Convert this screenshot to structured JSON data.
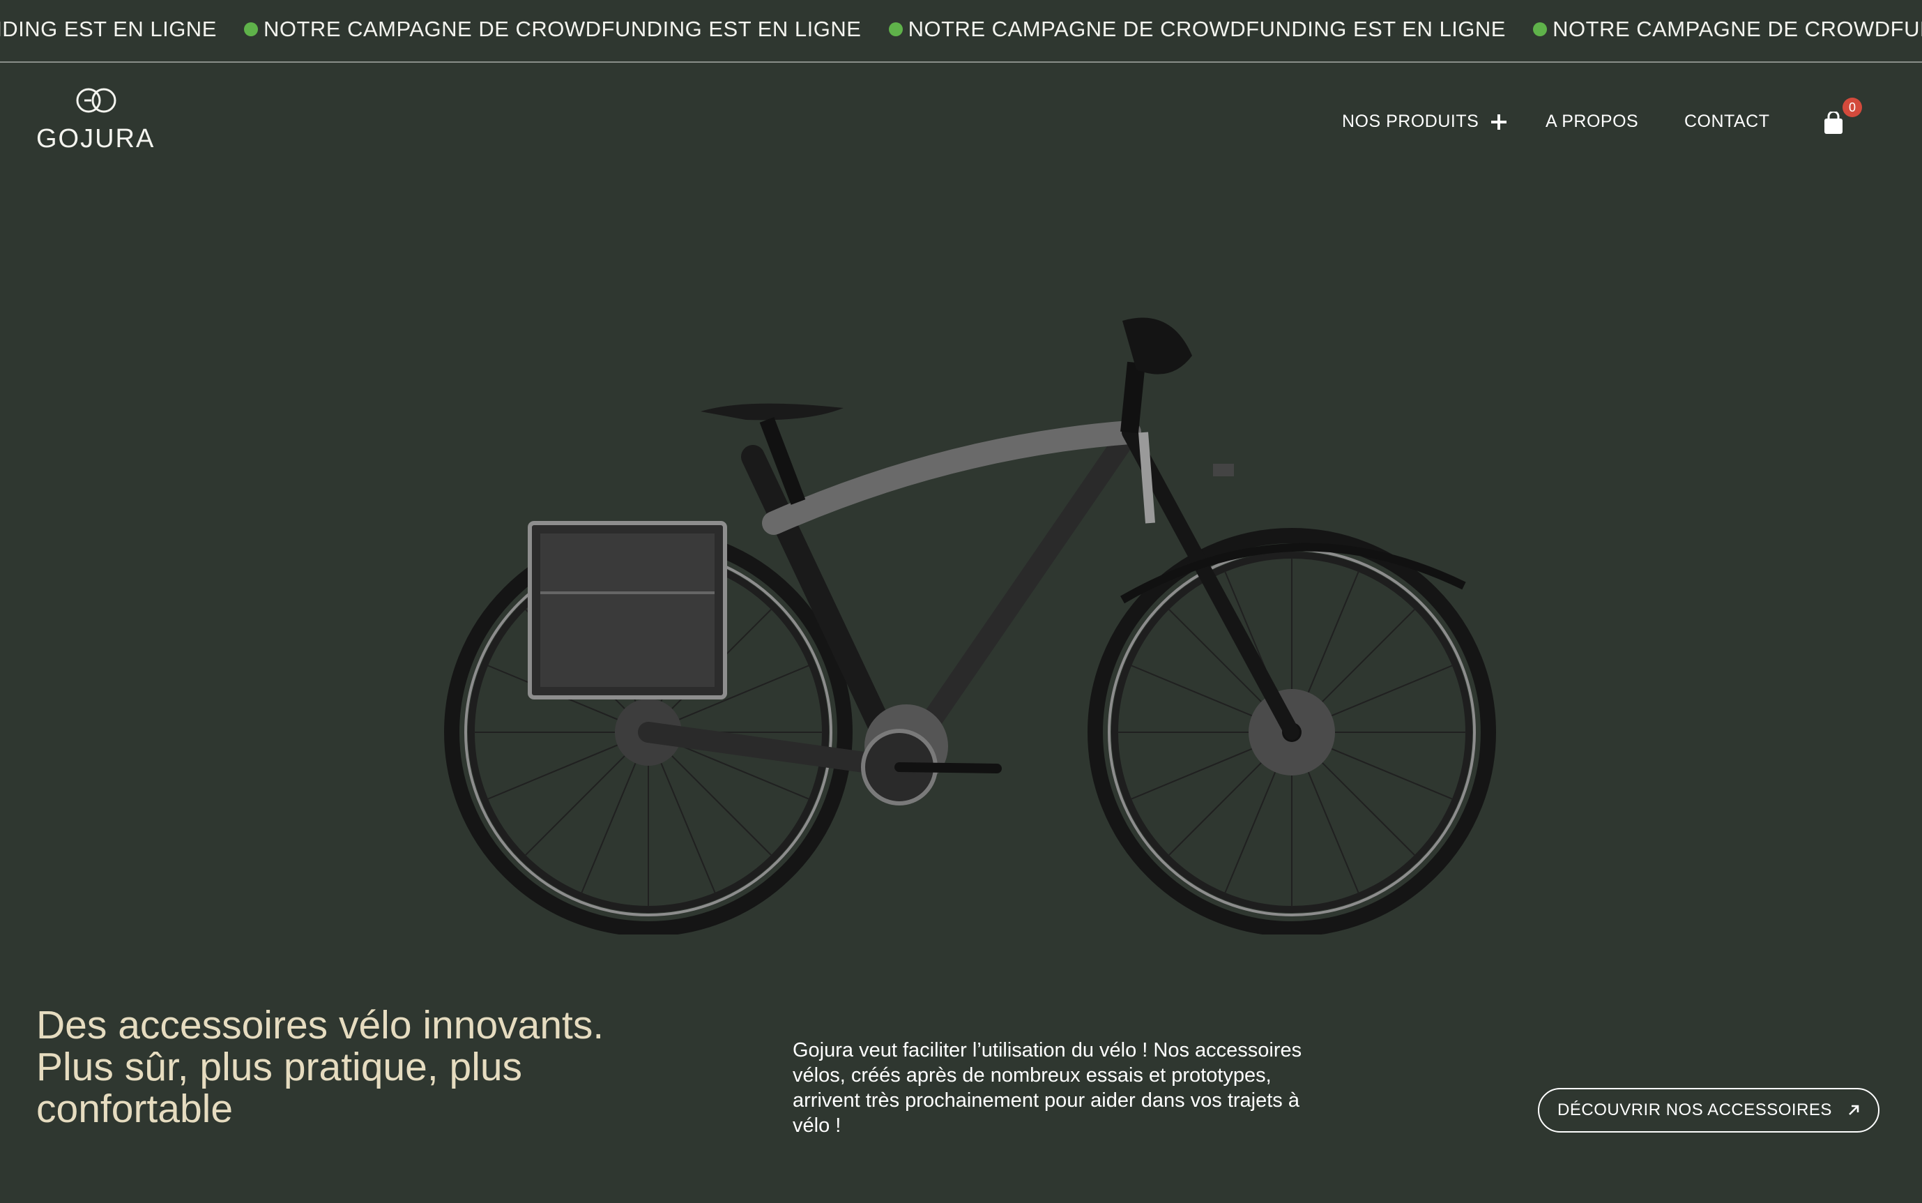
{
  "ticker": {
    "items": [
      "FUNDING EST EN LIGNE",
      "NOTRE CAMPAGNE DE CROWDFUNDING EST EN LIGNE",
      "NOTRE CAMPAGNE DE CROWDFUNDING EST EN LIGNE",
      "NOTRE CAMPAGNE DE CROWDFUNDING EST EN L"
    ],
    "dot_color": "#5fb24a"
  },
  "header": {
    "logo_text": "GOJURA",
    "nav": {
      "products": "NOS PRODUITS",
      "about": "A PROPOS",
      "contact": "CONTACT"
    },
    "cart_count": "0"
  },
  "hero": {
    "headline_lines": [
      "Des accessoires vélo innovants.",
      "Plus sûr, plus pratique, plus",
      "confortable"
    ],
    "description": "Gojura veut faciliter l’utilisation du vélo ! Nos accessoires vélos, créés après de nombreux essais et prototypes, arrivent très prochainement pour aider dans vos trajets à vélo !",
    "cta_label": "DÉCOUVRIR NOS ACCESSOIRES",
    "image": "bike-icon"
  },
  "colors": {
    "background": "#2f3730",
    "headline": "#e6dcc0",
    "badge": "#d34a3c",
    "accent_dot": "#5fb24a"
  }
}
